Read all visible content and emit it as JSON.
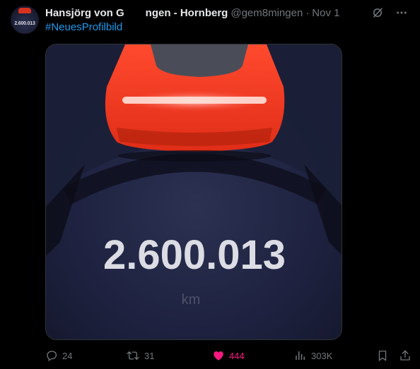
{
  "author": {
    "display_name": "Hansjörg von G    ngen - Hornberg",
    "handle": "@gem8mingen",
    "separator": "·",
    "date": "Nov 1",
    "avatar_text": "2.600.013"
  },
  "tweet": {
    "hashtag": "#NeuesProfilbild"
  },
  "media": {
    "odometer_value": "2.600.013",
    "odometer_unit": "km"
  },
  "actions": {
    "replies": "24",
    "reposts": "31",
    "likes": "444",
    "views": "303K"
  },
  "colors": {
    "link": "#1d9bf0",
    "like_active": "#f91880",
    "muted": "#71767b",
    "background": "#000000"
  },
  "icons": {
    "header": [
      "grok-icon",
      "more-icon"
    ],
    "actions": [
      "reply-icon",
      "repost-icon",
      "heart-icon",
      "views-icon",
      "bookmark-icon",
      "share-icon"
    ]
  }
}
